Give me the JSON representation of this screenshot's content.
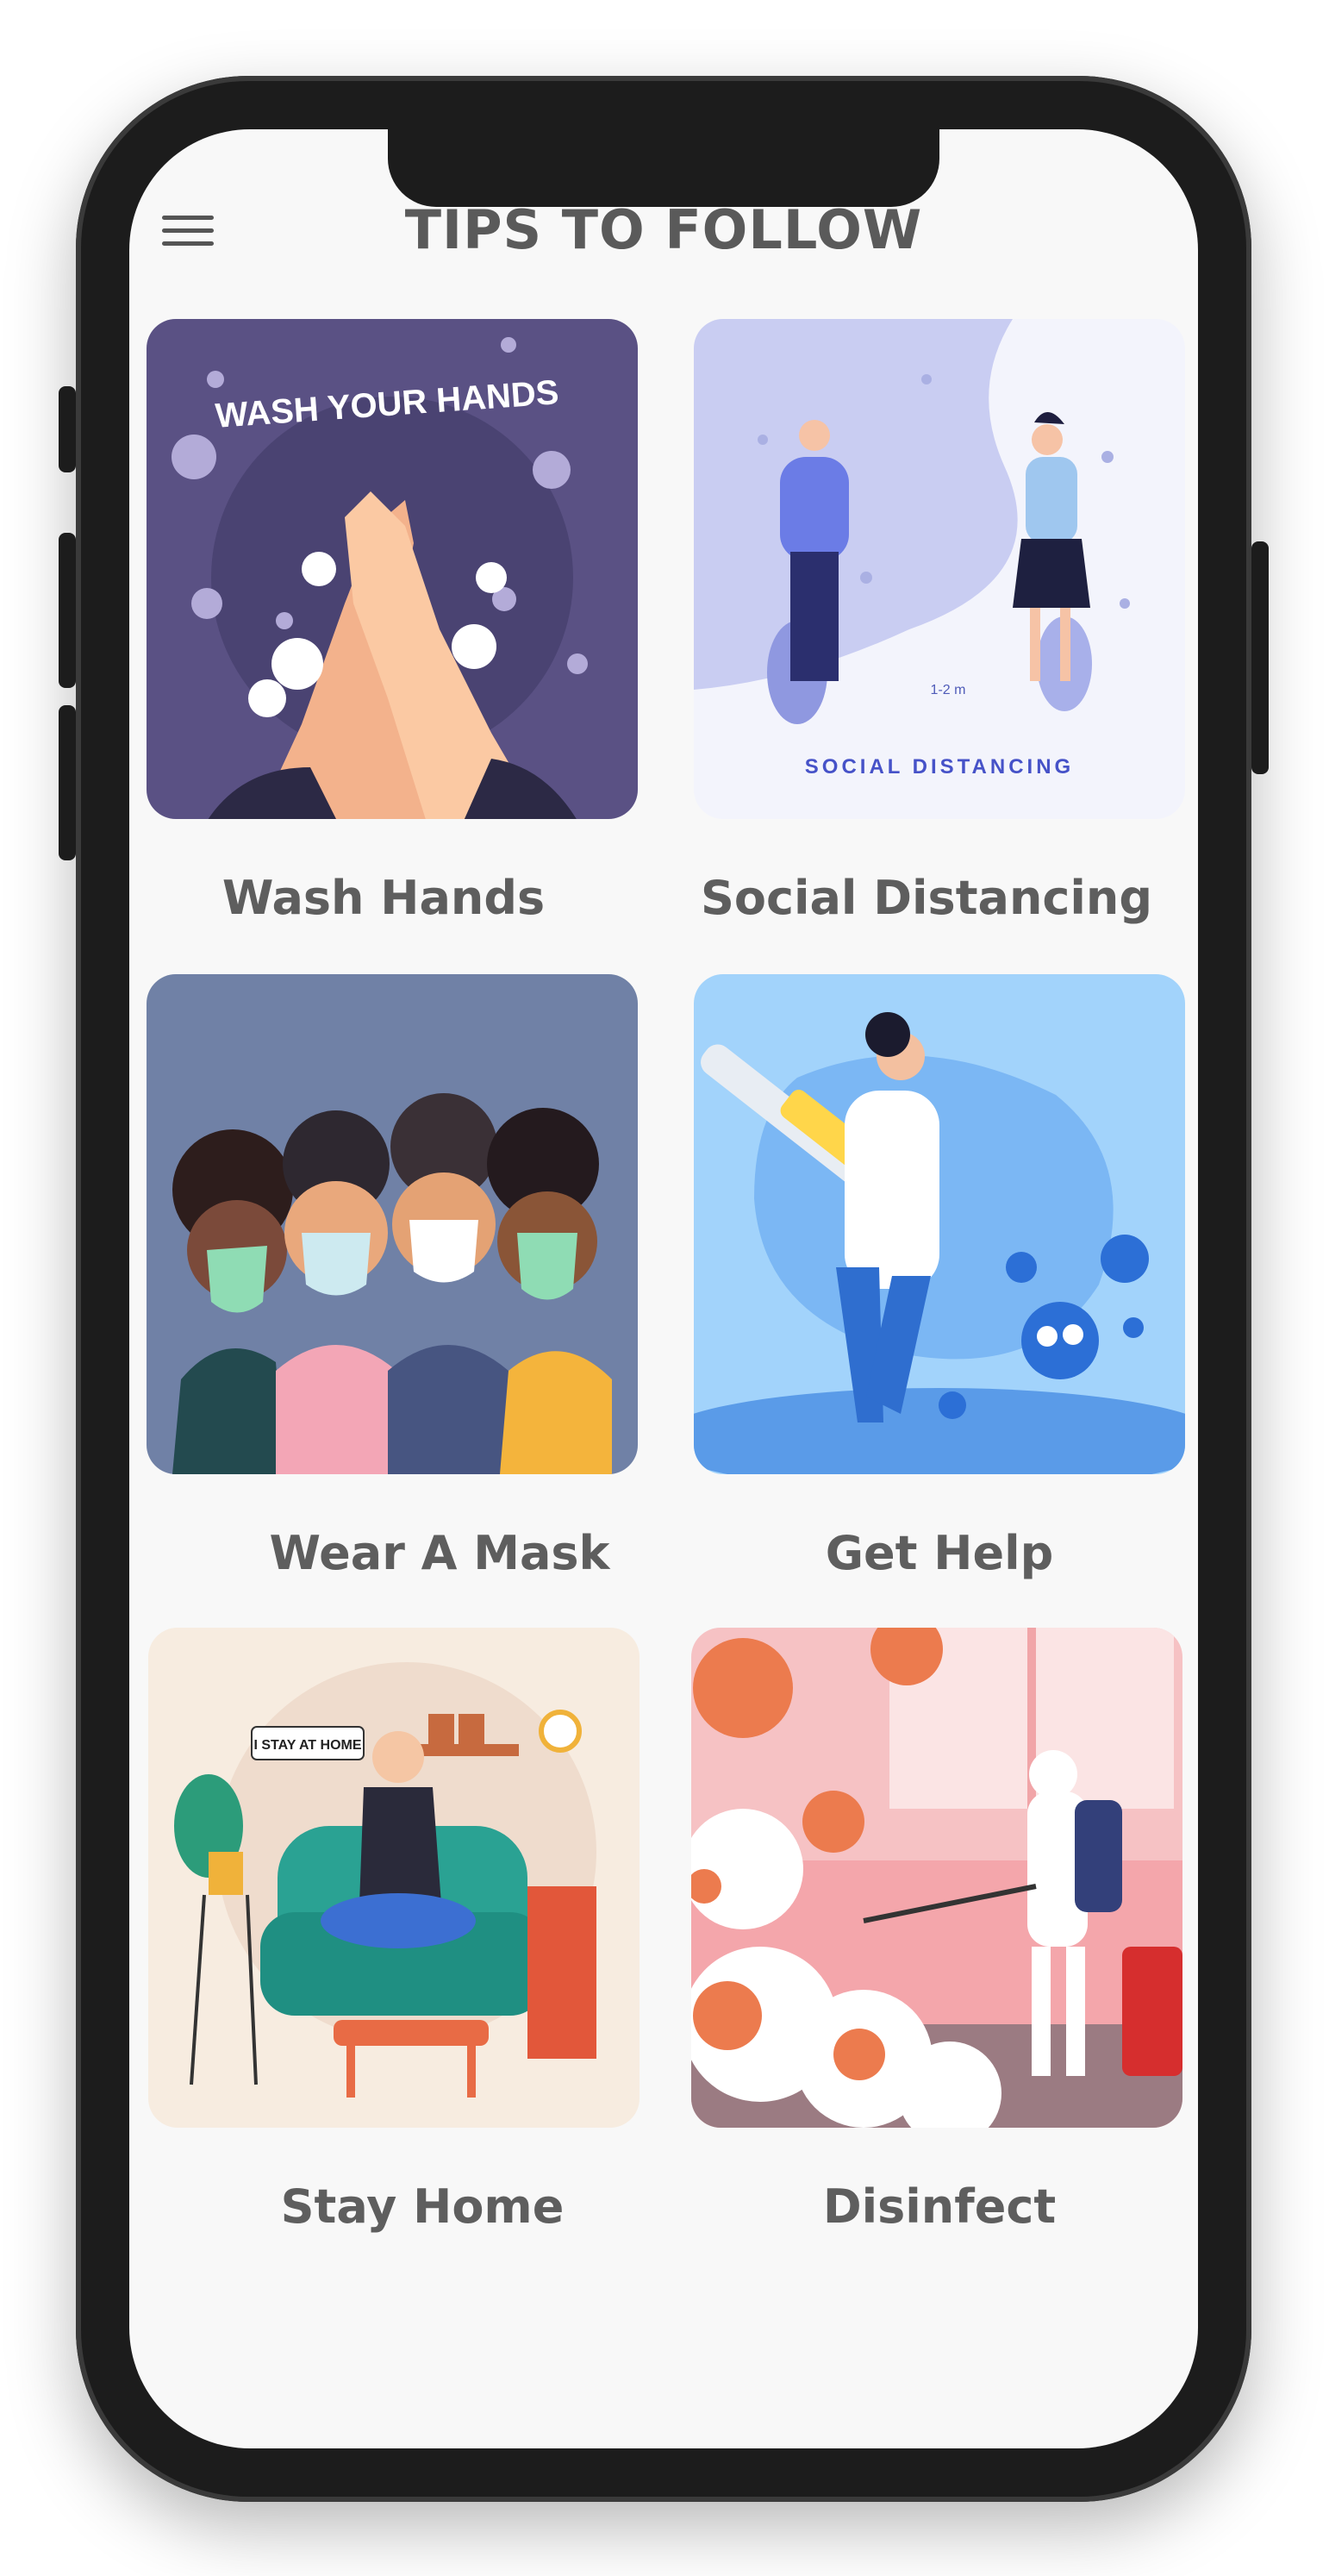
{
  "header": {
    "title": "TIPS TO FOLLOW",
    "menu_icon": "hamburger-menu-icon"
  },
  "tips": [
    {
      "label": "Wash Hands",
      "image_text": "WASH YOUR HANDS"
    },
    {
      "label": "Social Distancing",
      "image_text": "SOCIAL DISTANCING",
      "distance_text": "1-2 m"
    },
    {
      "label": "Wear A Mask"
    },
    {
      "label": "Get Help"
    },
    {
      "label": "Stay Home",
      "image_text": "I STAY AT HOME"
    },
    {
      "label": "Disinfect"
    }
  ],
  "colors": {
    "background": "#f8f8f8",
    "title": "#5a5a5a",
    "label": "#5e5e5e",
    "frame": "#1c1c1c"
  }
}
